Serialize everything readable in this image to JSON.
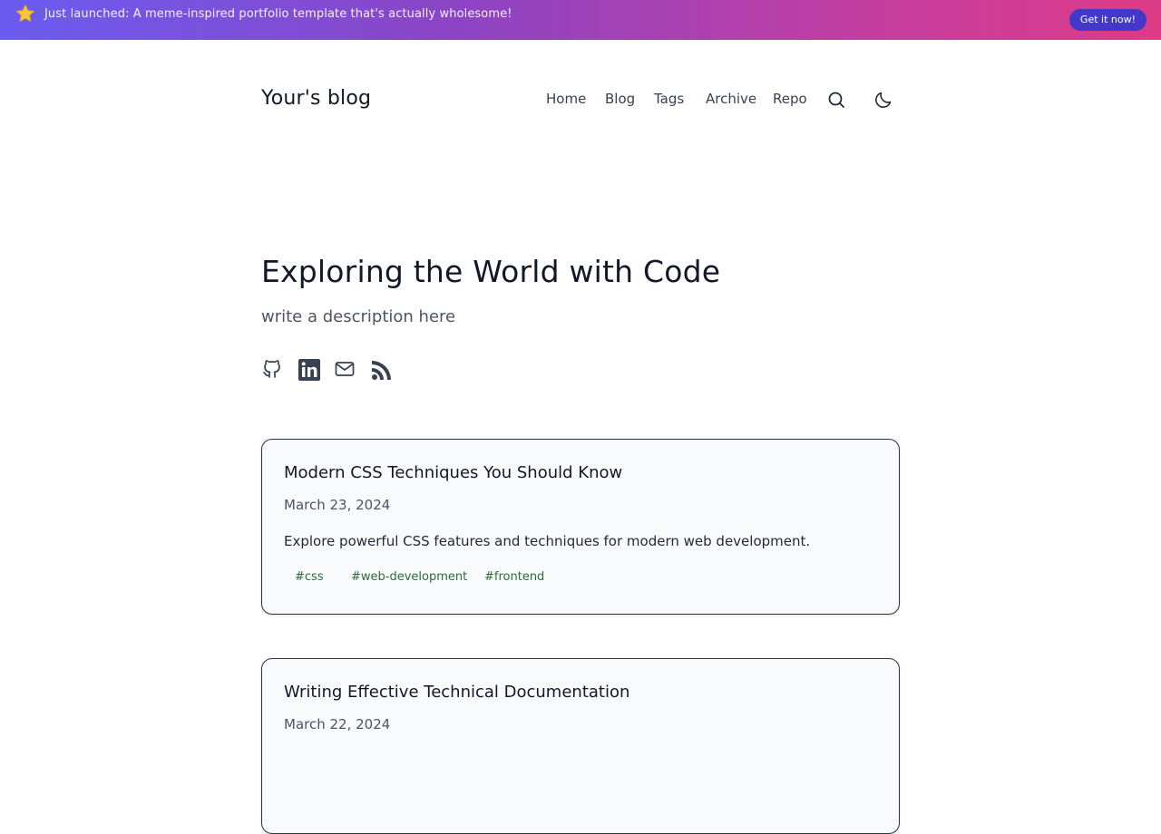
{
  "banner": {
    "icon": "star-icon",
    "icon_color": "#f7c531",
    "text": "Just launched: A meme-inspired portfolio template that's actually wholesome!",
    "cta_label": "Get it now!",
    "cta_color": "#4338ca",
    "gradient": [
      "#6a5cf0",
      "#dd3b86"
    ]
  },
  "header": {
    "site_title": "Your's blog",
    "nav": [
      {
        "label": "Home"
      },
      {
        "label": "Blog"
      },
      {
        "label": "Tags"
      },
      {
        "label": "Archive"
      },
      {
        "label": "Repo"
      }
    ],
    "icons": [
      "search-icon",
      "moon-icon"
    ]
  },
  "hero": {
    "title": "Exploring the World with Code",
    "description": "write a description here",
    "socials": [
      "github-icon",
      "linkedin-icon",
      "mail-icon",
      "rss-icon"
    ]
  },
  "posts": [
    {
      "title": "Modern CSS Techniques You Should Know",
      "date": "March 23, 2024",
      "excerpt": "Explore powerful CSS features and techniques for modern web development.",
      "tags": [
        "#css",
        "#web-development",
        "#frontend"
      ]
    },
    {
      "title": "Writing Effective Technical Documentation",
      "date": "March 22, 2024",
      "excerpt": "",
      "tags": []
    }
  ],
  "colors": {
    "text_primary": "#111827",
    "text_secondary": "#4b5563",
    "tag_color": "#2f6b3a",
    "card_border": "#2b3340",
    "card_background": "#f8fafc"
  }
}
